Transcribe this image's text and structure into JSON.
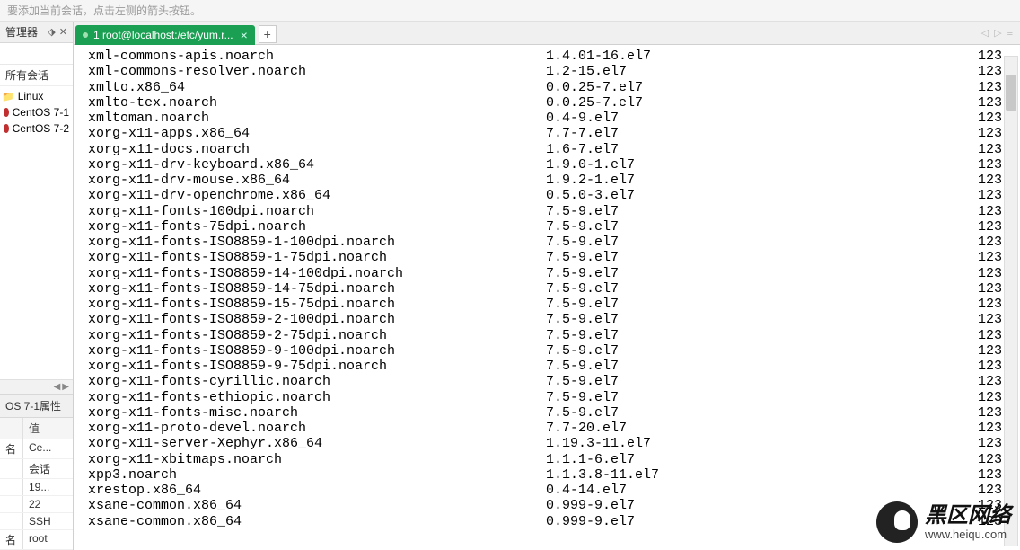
{
  "hint": "要添加当前会话，点击左侧的箭头按钮。",
  "sidebar": {
    "pane_title": "管理器",
    "all_sessions_label": "所有会话",
    "filter_value": "",
    "tree": {
      "root_label": "Linux",
      "children": [
        {
          "label": "CentOS 7-1"
        },
        {
          "label": "CentOS 7-2"
        }
      ]
    },
    "props": {
      "title": "OS 7-1属性",
      "header_value": "值",
      "rows": [
        {
          "name": "名",
          "value": "Ce..."
        },
        {
          "name": "",
          "value": "会话"
        },
        {
          "name": "",
          "value": "19..."
        },
        {
          "name": "",
          "value": "22"
        },
        {
          "name": "",
          "value": "SSH"
        },
        {
          "name": "名",
          "value": "root"
        }
      ]
    }
  },
  "tabs": {
    "active_label": "1 root@localhost:/etc/yum.r...",
    "add_label": "+"
  },
  "terminal": {
    "rows": [
      {
        "pkg": "xml-commons-apis.noarch",
        "ver": "1.4.01-16.el7",
        "repo": "123"
      },
      {
        "pkg": "xml-commons-resolver.noarch",
        "ver": "1.2-15.el7",
        "repo": "123"
      },
      {
        "pkg": "xmlto.x86_64",
        "ver": "0.0.25-7.el7",
        "repo": "123"
      },
      {
        "pkg": "xmlto-tex.noarch",
        "ver": "0.0.25-7.el7",
        "repo": "123"
      },
      {
        "pkg": "xmltoman.noarch",
        "ver": "0.4-9.el7",
        "repo": "123"
      },
      {
        "pkg": "xorg-x11-apps.x86_64",
        "ver": "7.7-7.el7",
        "repo": "123"
      },
      {
        "pkg": "xorg-x11-docs.noarch",
        "ver": "1.6-7.el7",
        "repo": "123"
      },
      {
        "pkg": "xorg-x11-drv-keyboard.x86_64",
        "ver": "1.9.0-1.el7",
        "repo": "123"
      },
      {
        "pkg": "xorg-x11-drv-mouse.x86_64",
        "ver": "1.9.2-1.el7",
        "repo": "123"
      },
      {
        "pkg": "xorg-x11-drv-openchrome.x86_64",
        "ver": "0.5.0-3.el7",
        "repo": "123"
      },
      {
        "pkg": "xorg-x11-fonts-100dpi.noarch",
        "ver": "7.5-9.el7",
        "repo": "123"
      },
      {
        "pkg": "xorg-x11-fonts-75dpi.noarch",
        "ver": "7.5-9.el7",
        "repo": "123"
      },
      {
        "pkg": "xorg-x11-fonts-ISO8859-1-100dpi.noarch",
        "ver": "7.5-9.el7",
        "repo": "123"
      },
      {
        "pkg": "xorg-x11-fonts-ISO8859-1-75dpi.noarch",
        "ver": "7.5-9.el7",
        "repo": "123"
      },
      {
        "pkg": "xorg-x11-fonts-ISO8859-14-100dpi.noarch",
        "ver": "7.5-9.el7",
        "repo": "123"
      },
      {
        "pkg": "xorg-x11-fonts-ISO8859-14-75dpi.noarch",
        "ver": "7.5-9.el7",
        "repo": "123"
      },
      {
        "pkg": "xorg-x11-fonts-ISO8859-15-75dpi.noarch",
        "ver": "7.5-9.el7",
        "repo": "123"
      },
      {
        "pkg": "xorg-x11-fonts-ISO8859-2-100dpi.noarch",
        "ver": "7.5-9.el7",
        "repo": "123"
      },
      {
        "pkg": "xorg-x11-fonts-ISO8859-2-75dpi.noarch",
        "ver": "7.5-9.el7",
        "repo": "123"
      },
      {
        "pkg": "xorg-x11-fonts-ISO8859-9-100dpi.noarch",
        "ver": "7.5-9.el7",
        "repo": "123"
      },
      {
        "pkg": "xorg-x11-fonts-ISO8859-9-75dpi.noarch",
        "ver": "7.5-9.el7",
        "repo": "123"
      },
      {
        "pkg": "xorg-x11-fonts-cyrillic.noarch",
        "ver": "7.5-9.el7",
        "repo": "123"
      },
      {
        "pkg": "xorg-x11-fonts-ethiopic.noarch",
        "ver": "7.5-9.el7",
        "repo": "123"
      },
      {
        "pkg": "xorg-x11-fonts-misc.noarch",
        "ver": "7.5-9.el7",
        "repo": "123"
      },
      {
        "pkg": "xorg-x11-proto-devel.noarch",
        "ver": "7.7-20.el7",
        "repo": "123"
      },
      {
        "pkg": "xorg-x11-server-Xephyr.x86_64",
        "ver": "1.19.3-11.el7",
        "repo": "123"
      },
      {
        "pkg": "xorg-x11-xbitmaps.noarch",
        "ver": "1.1.1-6.el7",
        "repo": "123"
      },
      {
        "pkg": "xpp3.noarch",
        "ver": "1.1.3.8-11.el7",
        "repo": "123"
      },
      {
        "pkg": "xrestop.x86_64",
        "ver": "0.4-14.el7",
        "repo": "123"
      },
      {
        "pkg": "xsane-common.x86_64",
        "ver": "0.999-9.el7",
        "repo": "123"
      },
      {
        "pkg": "xsane-common.x86_64",
        "ver": "0.999-9.el7",
        "repo": "123"
      }
    ]
  },
  "watermark": {
    "big": "黑区网络",
    "small": "www.heiqu.com"
  }
}
